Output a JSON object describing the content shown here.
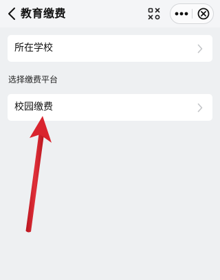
{
  "header": {
    "title": "教育缴费",
    "back_icon": "chevron-left-icon",
    "scan_icon": "scan-icon",
    "more_icon": "more-dots-icon",
    "close_icon": "close-circle-icon"
  },
  "school_selector": {
    "label": "所在学校",
    "icon": "chevron-right-icon"
  },
  "platform_section": {
    "title": "选择缴费平台",
    "items": [
      {
        "label": "校园缴费",
        "icon": "chevron-right-icon"
      }
    ]
  },
  "annotation": {
    "type": "arrow",
    "color": "#d9242e",
    "points_to": "校园缴费"
  },
  "colors": {
    "page_background": "#eef0f2",
    "card_background": "#ffffff",
    "chevron": "#c3c5c8"
  }
}
